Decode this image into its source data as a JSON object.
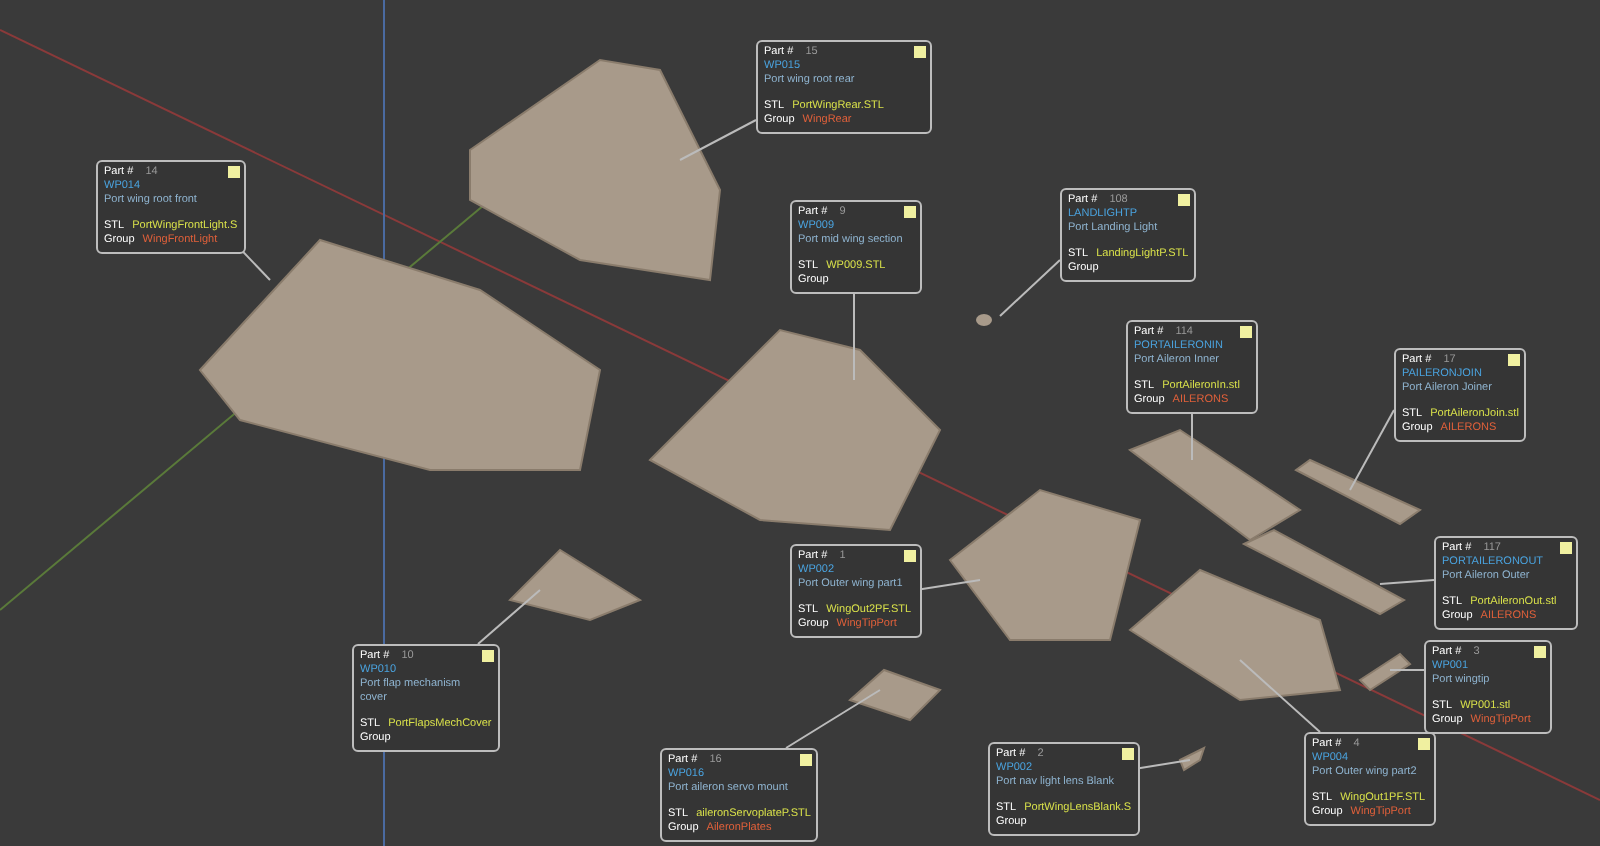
{
  "labels": [
    {
      "part_label": "Part #",
      "part_no": "15",
      "code": "WP015",
      "description": "Port wing root rear",
      "stl_label": "STL",
      "stl": "PortWingRear.STL",
      "group_label": "Group",
      "group": "WingRear"
    },
    {
      "part_label": "Part #",
      "part_no": "14",
      "code": "WP014",
      "description": "Port wing root front",
      "stl_label": "STL",
      "stl": "PortWingFrontLight.S",
      "group_label": "Group",
      "group": "WingFrontLight"
    },
    {
      "part_label": "Part #",
      "part_no": "9",
      "code": "WP009",
      "description": "Port mid wing section",
      "stl_label": "STL",
      "stl": "WP009.STL",
      "group_label": "Group"
    },
    {
      "part_label": "Part #",
      "part_no": "108",
      "code": "LANDLIGHTP",
      "description": "Port Landing Light",
      "stl_label": "STL",
      "stl": "LandingLightP.STL",
      "group_label": "Group"
    },
    {
      "part_label": "Part #",
      "part_no": "114",
      "code": "PORTAILERONIN",
      "description": "Port Aileron Inner",
      "stl_label": "STL",
      "stl": "PortAileronIn.stl",
      "group_label": "Group",
      "group": "AILERONS"
    },
    {
      "part_label": "Part #",
      "part_no": "17",
      "code": "PAILERONJOIN",
      "description": "Port Aileron Joiner",
      "stl_label": "STL",
      "stl": "PortAileronJoin.stl",
      "group_label": "Group",
      "group": "AILERONS"
    },
    {
      "part_label": "Part #",
      "part_no": "1",
      "code": "WP002",
      "description": "Port Outer wing part1",
      "stl_label": "STL",
      "stl": "WingOut2PF.STL",
      "group_label": "Group",
      "group": "WingTipPort"
    },
    {
      "part_label": "Part #",
      "part_no": "117",
      "code": "PORTAILERONOUT",
      "description": "Port Aileron Outer",
      "stl_label": "STL",
      "stl": "PortAileronOut.stl",
      "group_label": "Group",
      "group": "AILERONS"
    },
    {
      "part_label": "Part #",
      "part_no": "10",
      "code": "WP010",
      "description": "Port flap mechanism cover",
      "stl_label": "STL",
      "stl": "PortFlapsMechCover",
      "group_label": "Group"
    },
    {
      "part_label": "Part #",
      "part_no": "3",
      "code": "WP001",
      "description": "Port wingtip",
      "stl_label": "STL",
      "stl": "WP001.stl",
      "group_label": "Group",
      "group": "WingTipPort"
    },
    {
      "part_label": "Part #",
      "part_no": "16",
      "code": "WP016",
      "description": "Port aileron servo mount",
      "stl_label": "STL",
      "stl": "aileronServoplateP.STL",
      "group_label": "Group",
      "group": "AileronPlates"
    },
    {
      "part_label": "Part #",
      "part_no": "2",
      "code": "WP002",
      "description": "Port nav light lens Blank",
      "stl_label": "STL",
      "stl": "PortWingLensBlank.S",
      "group_label": "Group"
    },
    {
      "part_label": "Part #",
      "part_no": "4",
      "code": "WP004",
      "description": "Port Outer wing part2",
      "stl_label": "STL",
      "stl": "WingOut1PF.STL",
      "group_label": "Group",
      "group": "WingTipPort"
    }
  ]
}
